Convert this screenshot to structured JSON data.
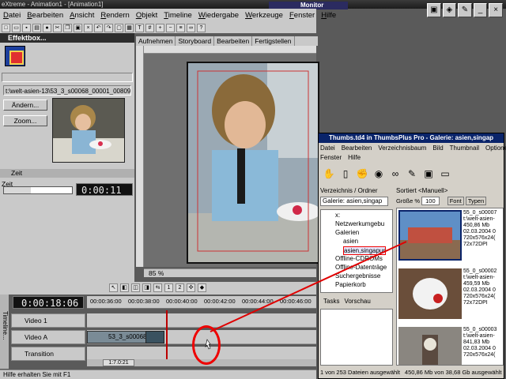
{
  "titlebar": {
    "title": "eXtreme - Animation1 - [Animation1]"
  },
  "monitor": {
    "label": "Monitor"
  },
  "menu": [
    "Datei",
    "Bearbeiten",
    "Ansicht",
    "Rendern",
    "Objekt",
    "Timeline",
    "Wiedergabe",
    "Werkzeuge",
    "Fenster",
    "Hilfe"
  ],
  "effects": {
    "title": "Effektbox...",
    "clip_path": "t:\\welt-asien-13\\53_3_s00068_00001_00809...",
    "btn_aendern": "Ändern...",
    "btn_zoom": "Zoom...",
    "zeit_section": "Zeit",
    "zeit_caption": "Zeit",
    "timecode": "0:00:11"
  },
  "viewer": {
    "tabs": [
      "Aufnehmen",
      "Storyboard",
      "Bearbeiten",
      "Fertigstellen"
    ],
    "zoom": "85 %"
  },
  "timeline": {
    "label": "Timeline...",
    "timecode": "0:00:18:06",
    "ruler_ticks": [
      "00:00:36:00",
      "00:00:38:00",
      "00:00:40:00",
      "00:00:42:00",
      "00:00:44:00",
      "00:00:46:00"
    ],
    "tracks": [
      "Video 1",
      "Video A",
      "Transition"
    ],
    "clip_label": "53_3_s00068",
    "zoom_value": "1:7.0:21"
  },
  "status": {
    "text": "Hilfe erhalten Sie mit F1"
  },
  "thumbsplus": {
    "title": "Thumbs.td4 in ThumbsPlus Pro - Galerie: asien,singap",
    "menu1": [
      "Datei",
      "Bearbeiten",
      "Verzeichnisbaum",
      "Bild",
      "Thumbnail",
      "Optionen"
    ],
    "menu2": [
      "Fenster",
      "Hilfe"
    ],
    "left_header": "Verzeichnis / Ordner",
    "right_header": "Sortiert <Manuell>",
    "gallery_value": "Galerie: asien,singap",
    "size_label": "Größe %",
    "size_value": "100",
    "font_label": "Font",
    "type_label": "Typen",
    "tree": [
      "x:",
      "Netzwerkumgebu",
      "Galerien",
      "asien",
      "asien,singapur",
      "Offline-CDROMs",
      "Offline-Datenträge",
      "Suchergebnisse",
      "Papierkorb"
    ],
    "tabs": [
      "Tasks",
      "Vorschau"
    ],
    "thumbs": [
      {
        "name": "55_0_s00007",
        "path": "t:\\welt-asien-",
        "size": "450,86 Mb",
        "date": "02.03.2004 0",
        "dims": "720x576x24(",
        "dpi": "72x72DPI"
      },
      {
        "name": "55_0_s00002",
        "path": "t:\\welt-asien-",
        "size": "459,59 Mb",
        "date": "02.03.2004 0",
        "dims": "720x576x24(",
        "dpi": "72x72DPI"
      },
      {
        "name": "55_0_s00003",
        "path": "t:\\welt-asien-",
        "size": "841,83 Mb",
        "date": "02.03.2004 0",
        "dims": "720x576x24(",
        "dpi": ""
      }
    ],
    "status_left": "1 von 253 Dateien ausgewählt",
    "status_right": "450,86 Mb von 38,68 Gb ausgewählt"
  },
  "colors": {
    "accent_red": "#e00000",
    "title_blue": "#0a246a"
  }
}
